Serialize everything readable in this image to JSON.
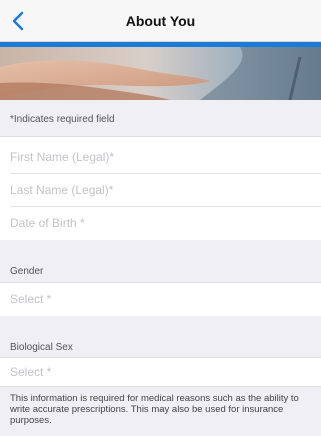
{
  "header": {
    "title": "About You",
    "back_icon": "chevron-left-icon"
  },
  "colors": {
    "accent": "#1c7bd4",
    "background": "#efeff4"
  },
  "required_note": "*Indicates required field",
  "fields": {
    "first_name": "First Name (Legal)*",
    "last_name": "Last Name (Legal)*",
    "dob": "Date of Birth *"
  },
  "gender": {
    "label": "Gender",
    "placeholder": "Select *"
  },
  "bio_sex": {
    "label": "Biological Sex",
    "placeholder": "Select *"
  },
  "footer_note": "This information is required for medical reasons such as the ability to write accurate prescriptions. This may also be used for insurance purposes."
}
